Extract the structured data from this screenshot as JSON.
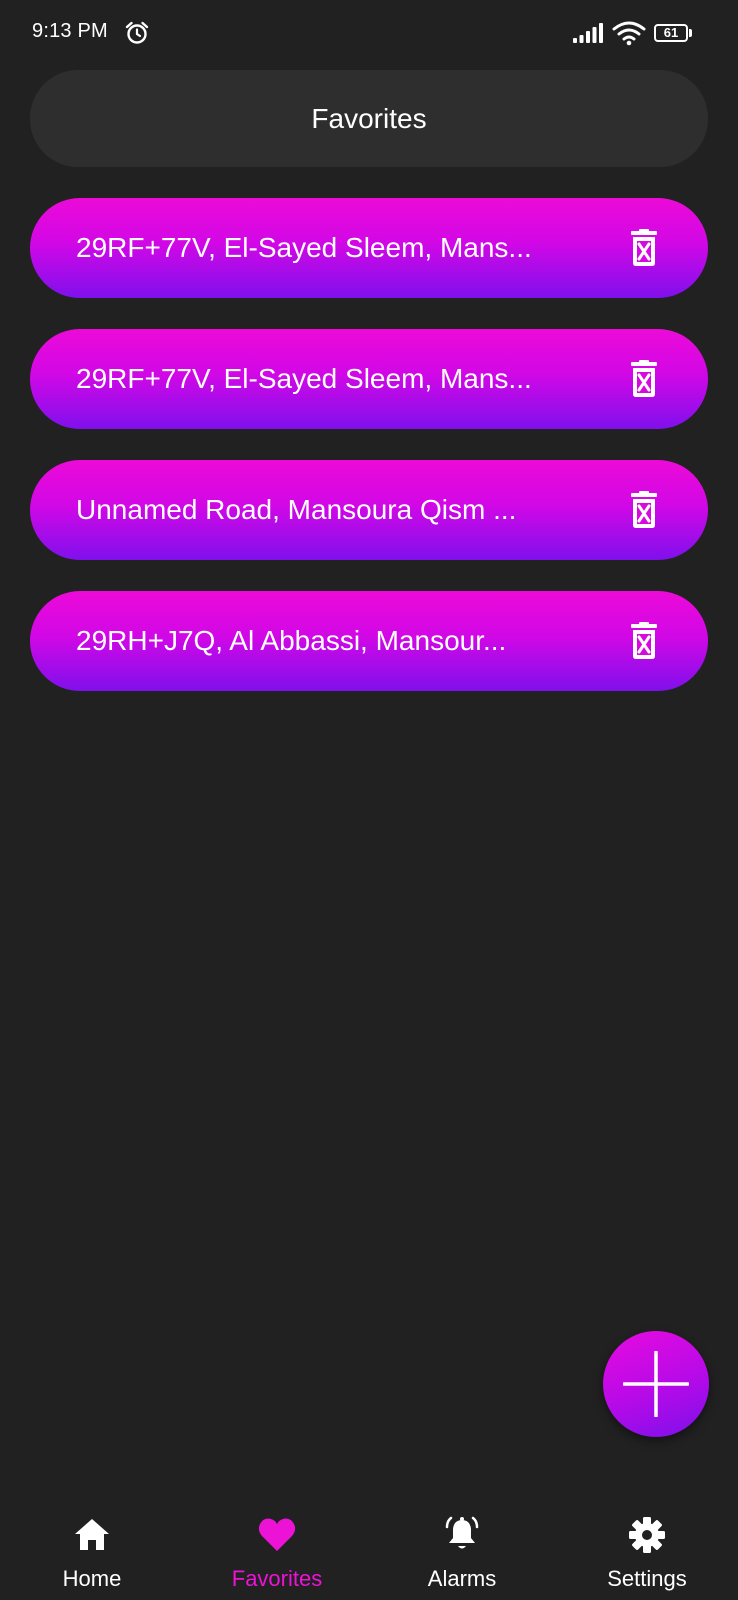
{
  "status_bar": {
    "time": "9:13 PM",
    "battery_level": "61",
    "icons": [
      "alarm-clock-icon",
      "signal-icon",
      "wifi-icon",
      "battery-icon"
    ]
  },
  "header": {
    "title": "Favorites"
  },
  "favorites": [
    {
      "label": "29RF+77V, El-Sayed Sleem, Mans...",
      "delete_icon": "delete-icon"
    },
    {
      "label": "29RF+77V, El-Sayed Sleem, Mans...",
      "delete_icon": "delete-icon"
    },
    {
      "label": "Unnamed Road, Mansoura Qism ...",
      "delete_icon": "delete-icon"
    },
    {
      "label": "29RH+J7Q, Al Abbassi, Mansour...",
      "delete_icon": "delete-icon"
    }
  ],
  "fab": {
    "icon": "plus-icon"
  },
  "bottom_nav": {
    "items": [
      {
        "label": "Home",
        "icon": "home-icon",
        "active": false
      },
      {
        "label": "Favorites",
        "icon": "heart-icon",
        "active": true
      },
      {
        "label": "Alarms",
        "icon": "bell-icon",
        "active": false
      },
      {
        "label": "Settings",
        "icon": "gear-icon",
        "active": false
      }
    ]
  },
  "colors": {
    "background": "#212121",
    "header_background": "#2e2e2e",
    "accent": "#ec12d6",
    "gradient_top": "#ec0ad8",
    "gradient_bottom": "#7f10ec",
    "text": "#ffffff"
  }
}
